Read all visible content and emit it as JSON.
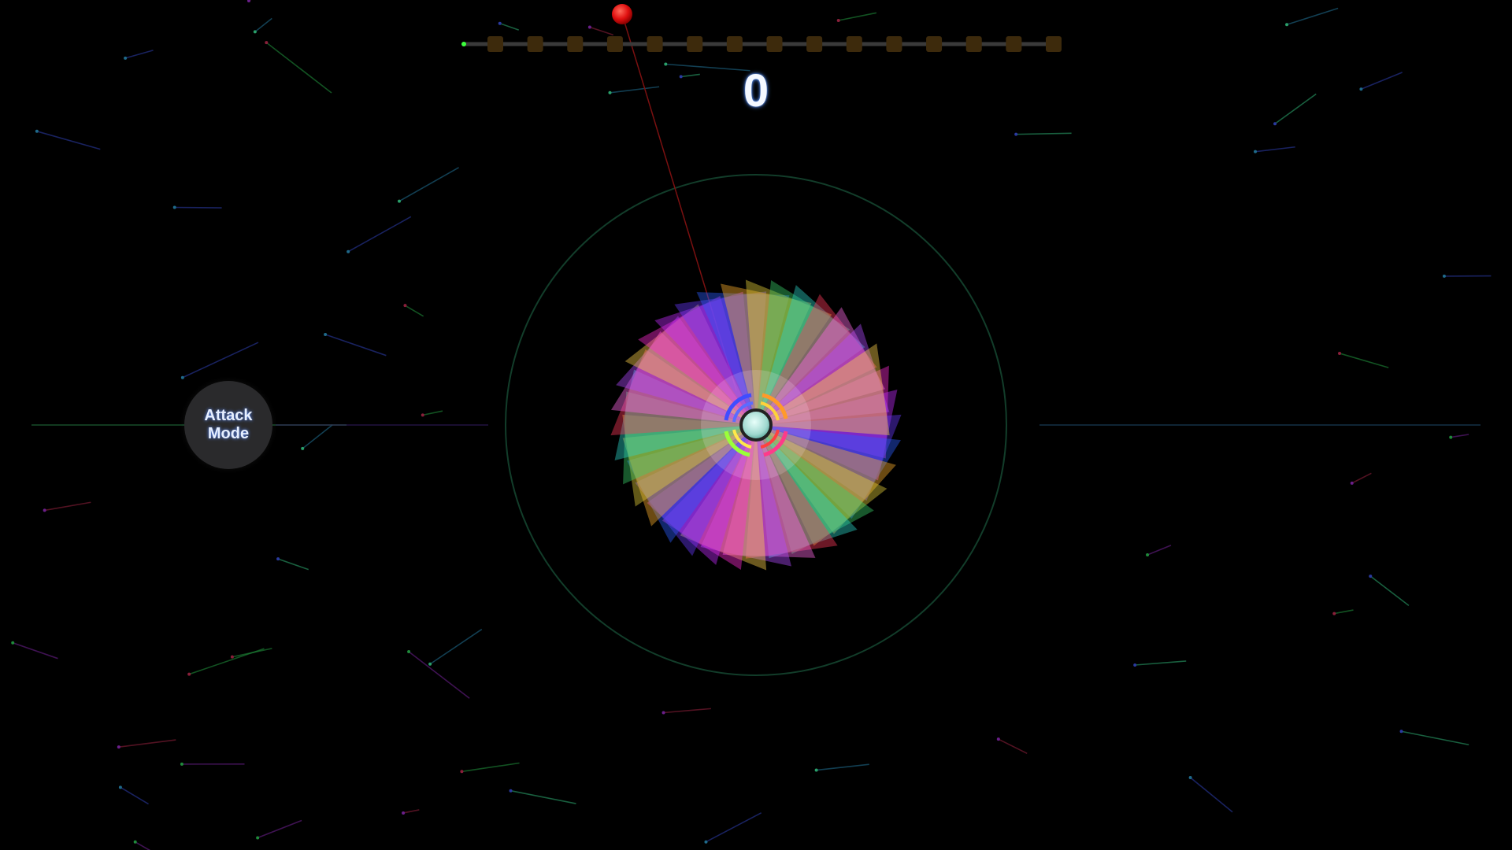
{
  "hud": {
    "score": "0",
    "progress_nodes_total": 15,
    "progress_nodes_filled": 0
  },
  "controls": {
    "attack_mode_label": "Attack\nMode"
  },
  "colors": {
    "background": "#000000",
    "progress_track": "#3a3a3a",
    "progress_node": "#3d2a0c",
    "progress_start": "#3cff3c",
    "enemy": "#e01010",
    "orbit_ring": "#123d2a",
    "core": "#9fd8cf",
    "button_bg": "#2a2a2c",
    "score_glow": "#4f8dff"
  },
  "icons": {
    "core": "player-core-icon",
    "enemy": "enemy-orb-icon",
    "flower": "prismatic-shield-icon"
  }
}
